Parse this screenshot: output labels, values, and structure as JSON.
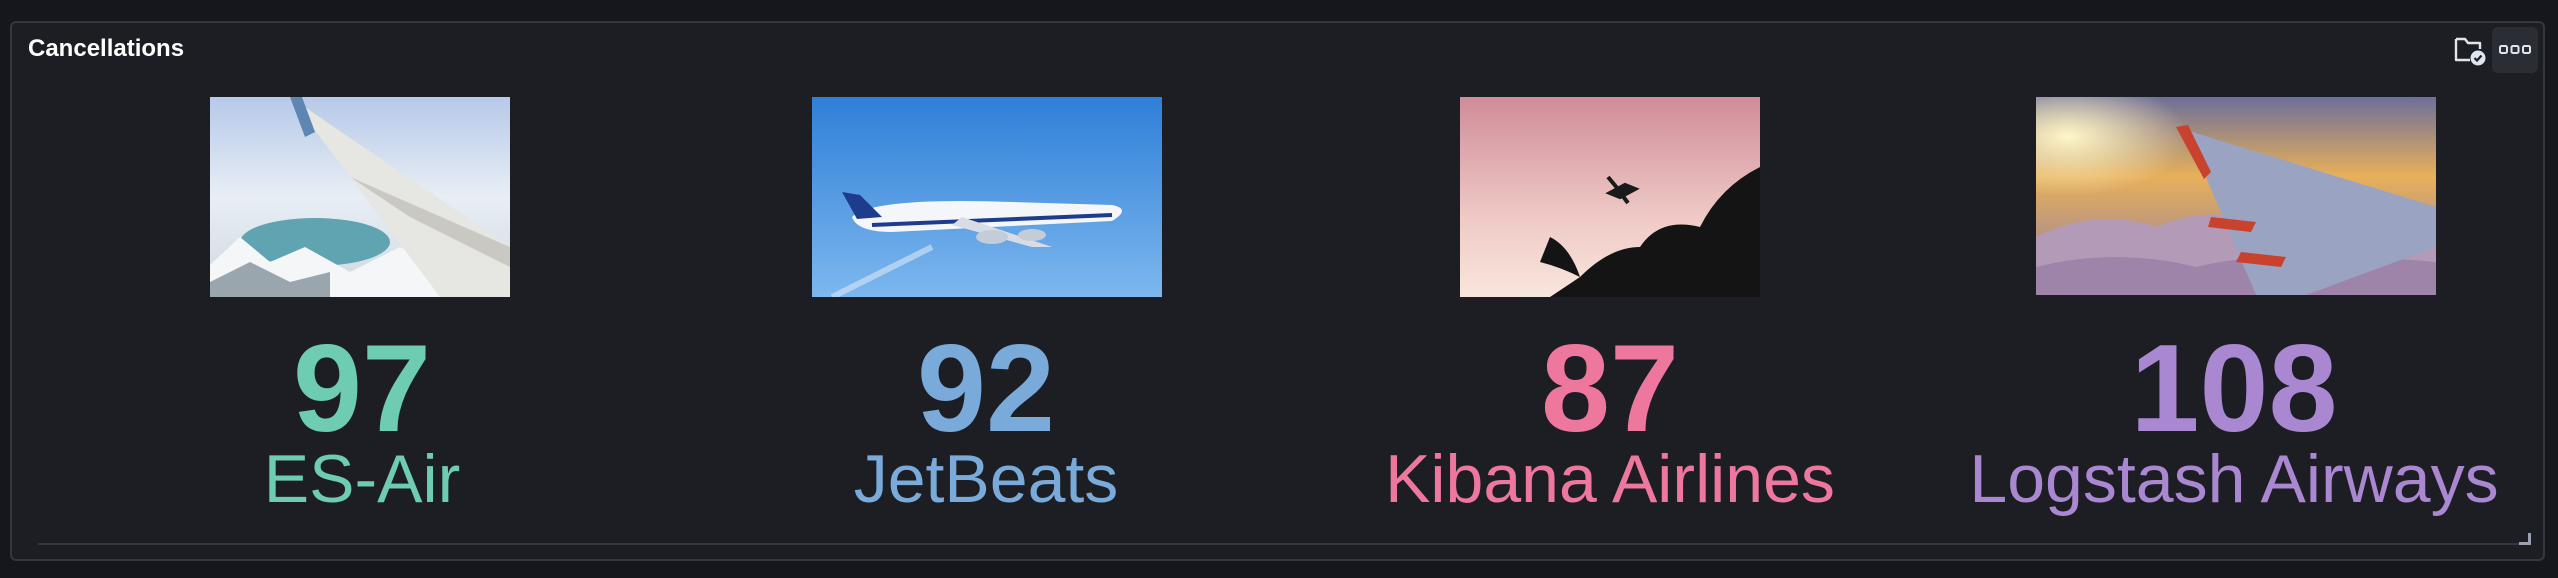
{
  "panel": {
    "title": "Cancellations"
  },
  "tiles": [
    {
      "value": "97",
      "name": "ES-Air",
      "color": "#6dccb1",
      "image": "airplane-wing-over-lake-image"
    },
    {
      "value": "92",
      "name": "JetBeats",
      "color": "#79aad9",
      "image": "airliner-takeoff-image"
    },
    {
      "value": "87",
      "name": "Kibana Airlines",
      "color": "#ee789d",
      "image": "plane-over-palm-trees-image"
    },
    {
      "value": "108",
      "name": "Logstash Airways",
      "color": "#a987d1",
      "image": "wing-above-clouds-sunset-image"
    }
  ],
  "icons": {
    "folder": "folder-check-icon",
    "more": "more-options-icon"
  }
}
